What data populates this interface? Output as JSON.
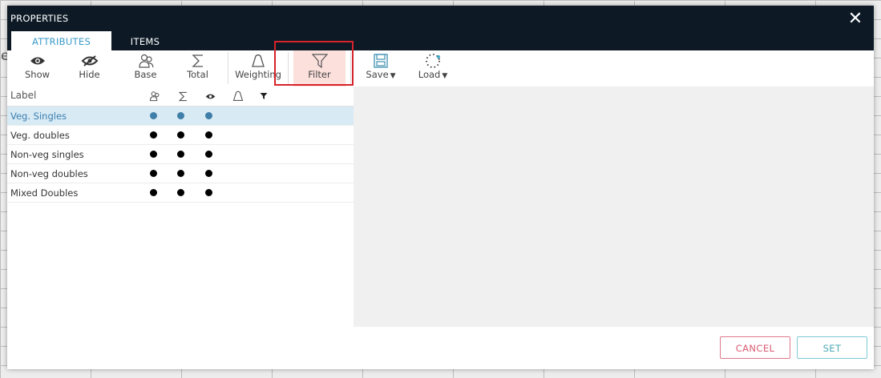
{
  "dialog": {
    "title": "PROPERTIES",
    "close_glyph": "✕"
  },
  "tabs": [
    {
      "label": "ATTRIBUTES",
      "active": true
    },
    {
      "label": "ITEMS",
      "active": false
    }
  ],
  "toolbar": {
    "show": "Show",
    "hide": "Hide",
    "base": "Base",
    "total": "Total",
    "weighting": "Weighting",
    "filter": "Filter",
    "save": "Save",
    "load": "Load",
    "dropdown_arrow": "▼"
  },
  "table": {
    "header_label": "Label",
    "rows": [
      {
        "label": "Veg. Singles",
        "selected": true
      },
      {
        "label": "Veg. doubles",
        "selected": false
      },
      {
        "label": "Non-veg singles",
        "selected": false
      },
      {
        "label": "Non-veg doubles",
        "selected": false
      },
      {
        "label": "Mixed Doubles",
        "selected": false
      }
    ]
  },
  "buttons": {
    "cancel": "CANCEL",
    "set": "SET"
  },
  "background": {
    "letter": "e"
  },
  "colors": {
    "titlebar": "#0d1a26",
    "tab_active_text": "#3a9bc9",
    "selected_row": "#d8eaf4",
    "highlight": "#d7232a",
    "filter_bg": "#fce0dc",
    "cancel": "#d95b73",
    "set": "#4aa8b6"
  }
}
